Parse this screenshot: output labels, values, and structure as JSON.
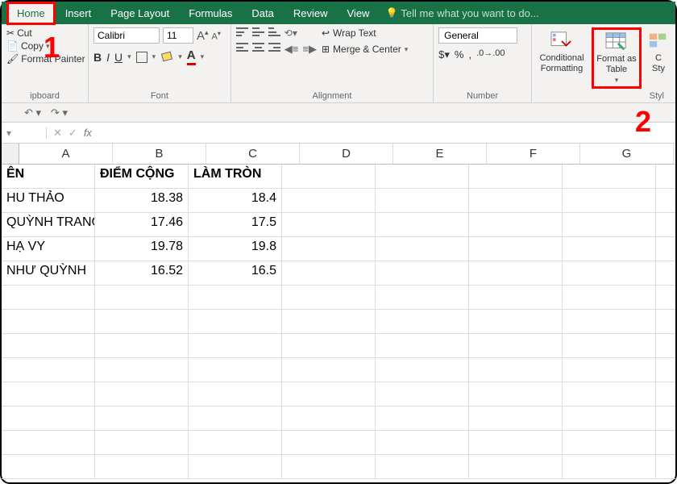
{
  "tabs": [
    "Home",
    "Insert",
    "Page Layout",
    "Formulas",
    "Data",
    "Review",
    "View"
  ],
  "tellme": "Tell me what you want to do...",
  "clipboard": {
    "cut": "Cut",
    "copy": "Copy",
    "fp": "Format Painter",
    "label": "ipboard"
  },
  "font": {
    "name": "Calibri",
    "size": "11",
    "label": "Font"
  },
  "alignment": {
    "wrap": "Wrap Text",
    "merge": "Merge & Center",
    "label": "Alignment"
  },
  "number": {
    "format": "General",
    "label": "Number"
  },
  "styles": {
    "cond": "Conditional Formatting",
    "fmt": "Format as Table",
    "cell": "C\nSty",
    "label": "Styl"
  },
  "annotations": {
    "one": "1",
    "two": "2"
  },
  "columns": [
    "A",
    "B",
    "C",
    "D",
    "E",
    "F",
    "G"
  ],
  "sheet": {
    "headers": [
      "ÊN",
      "ĐIỂM CỘNG",
      "LÀM TRÒN"
    ],
    "rows": [
      {
        "name": "HU THẢO",
        "b": "18.38",
        "c": "18.4"
      },
      {
        "name": "QUỲNH TRANG",
        "b": "17.46",
        "c": "17.5"
      },
      {
        "name": "HẠ VY",
        "b": "19.78",
        "c": "19.8"
      },
      {
        "name": "NHƯ QUỲNH",
        "b": "16.52",
        "c": "16.5"
      }
    ]
  }
}
